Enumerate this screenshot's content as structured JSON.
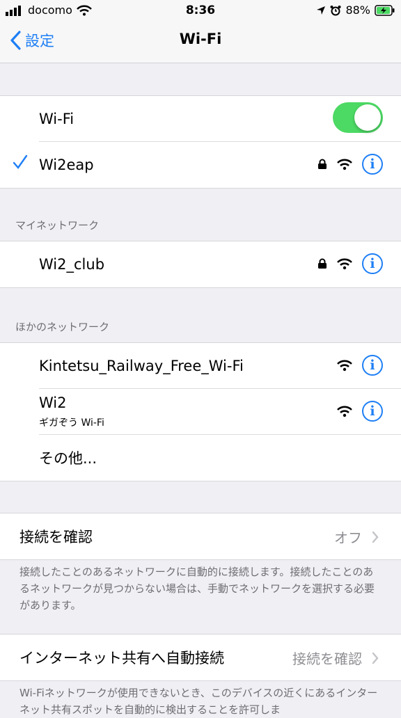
{
  "status": {
    "carrier": "docomo",
    "time": "8:36",
    "battery": "88%"
  },
  "nav": {
    "back_label": "設定",
    "title": "Wi-Fi"
  },
  "wifi": {
    "toggle_label": "Wi-Fi",
    "connected": "Wi2eap"
  },
  "my_networks": {
    "header": "マイネットワーク",
    "items": [
      "Wi2_club"
    ]
  },
  "other_networks": {
    "header": "ほかのネットワーク",
    "items": [
      {
        "name": "Kintetsu_Railway_Free_Wi-Fi"
      },
      {
        "name": "Wi2",
        "subtitle": "ギガぞう Wi-Fi"
      }
    ],
    "other_label": "その他..."
  },
  "ask_join": {
    "label": "接続を確認",
    "value": "オフ",
    "footer": "接続したことのあるネットワークに自動的に接続します。接続したことのあるネットワークが見つからない場合は、手動でネットワークを選択する必要があります。"
  },
  "hotspot": {
    "label": "インターネット共有へ自動接続",
    "value": "接続を確認",
    "footer": "Wi-Fiネットワークが使用できないとき、このデバイスの近くにあるインターネット共有スポットを自動的に検出することを許可しま"
  },
  "colors": {
    "accent": "#1e7ff5",
    "toggle_on": "#4cd964"
  }
}
